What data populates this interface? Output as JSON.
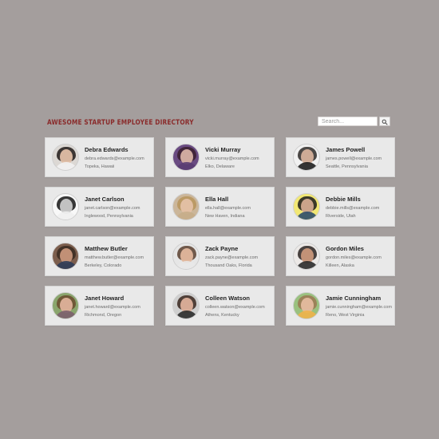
{
  "header": {
    "title": "Awesome Startup Employee Directory",
    "search": {
      "placeholder": "Search...",
      "value": "",
      "button_icon": "search-icon"
    }
  },
  "employees": [
    {
      "name": "Debra Edwards",
      "email": "debra.edwards@example.com",
      "location": "Topeka, Hawaii",
      "avatar": {
        "skin": "#e0bfa7",
        "hair": "#201a17",
        "shirt": "#f2f2f2",
        "bg": "#dcd8d4"
      }
    },
    {
      "name": "Vicki Murray",
      "email": "vicki.murray@example.com",
      "location": "Elko, Delaware",
      "avatar": {
        "skin": "#d7b1a4",
        "hair": "#3a1f2e",
        "shirt": "#5a3d72",
        "bg": "#6a4b82"
      }
    },
    {
      "name": "James Powell",
      "email": "james.powell@example.com",
      "location": "Seattle, Pennsylvania",
      "avatar": {
        "skin": "#d5b19b",
        "hair": "#2e2a28",
        "shirt": "#1f1f1f",
        "bg": "#f1f1f1"
      }
    },
    {
      "name": "Janet Carlson",
      "email": "janet.carlson@example.com",
      "location": "Inglewood, Pennsylvania",
      "avatar": {
        "skin": "#c9c9c9",
        "hair": "#151515",
        "shirt": "#efefef",
        "bg": "#f8f8f8"
      }
    },
    {
      "name": "Ella Hall",
      "email": "ella.hall@example.com",
      "location": "New Haven, Indiana",
      "avatar": {
        "skin": "#e4c1a6",
        "hair": "#b8955c",
        "shirt": "#c6ad89",
        "bg": "#cbb69a"
      }
    },
    {
      "name": "Debbie Mills",
      "email": "debbie.mills@example.com",
      "location": "Riverside, Utah",
      "avatar": {
        "skin": "#d2aa8f",
        "hair": "#1b1a1b",
        "shirt": "#2c4d6a",
        "bg": "#f1e774"
      }
    },
    {
      "name": "Matthew Butler",
      "email": "matthew.butler@example.com",
      "location": "Berkeley, Colorado",
      "avatar": {
        "skin": "#c8967a",
        "hair": "#3a2a21",
        "shirt": "#2f3c58",
        "bg": "#7c5e4d"
      }
    },
    {
      "name": "Zack Payne",
      "email": "zack.payne@example.com",
      "location": "Thousand Oaks, Florida",
      "avatar": {
        "skin": "#e2b79c",
        "hair": "#5a3f2f",
        "shirt": "#e8e8e8",
        "bg": "#e6e6e6"
      }
    },
    {
      "name": "Gordon Miles",
      "email": "gordon.miles@example.com",
      "location": "Killeen, Alaska",
      "avatar": {
        "skin": "#c9977a",
        "hair": "#2b2321",
        "shirt": "#2b2b2b",
        "bg": "#ece9e7"
      }
    },
    {
      "name": "Janet Howard",
      "email": "janet.howard@example.com",
      "location": "Richmond, Oregon",
      "avatar": {
        "skin": "#deb29a",
        "hair": "#6a4a2e",
        "shirt": "#7b5f6d",
        "bg": "#8aa56d"
      }
    },
    {
      "name": "Colleen Watson",
      "email": "colleen.watson@example.com",
      "location": "Athens, Kentucky",
      "avatar": {
        "skin": "#ddb09a",
        "hair": "#3a271f",
        "shirt": "#2a2a2a",
        "bg": "#cfcfcf"
      }
    },
    {
      "name": "Jamie Cunningham",
      "email": "jamie.cunningham@example.com",
      "location": "Reno, West Virginia",
      "avatar": {
        "skin": "#e4bb9f",
        "hair": "#9b7752",
        "shirt": "#f0b24a",
        "bg": "#9ac17f"
      }
    }
  ]
}
